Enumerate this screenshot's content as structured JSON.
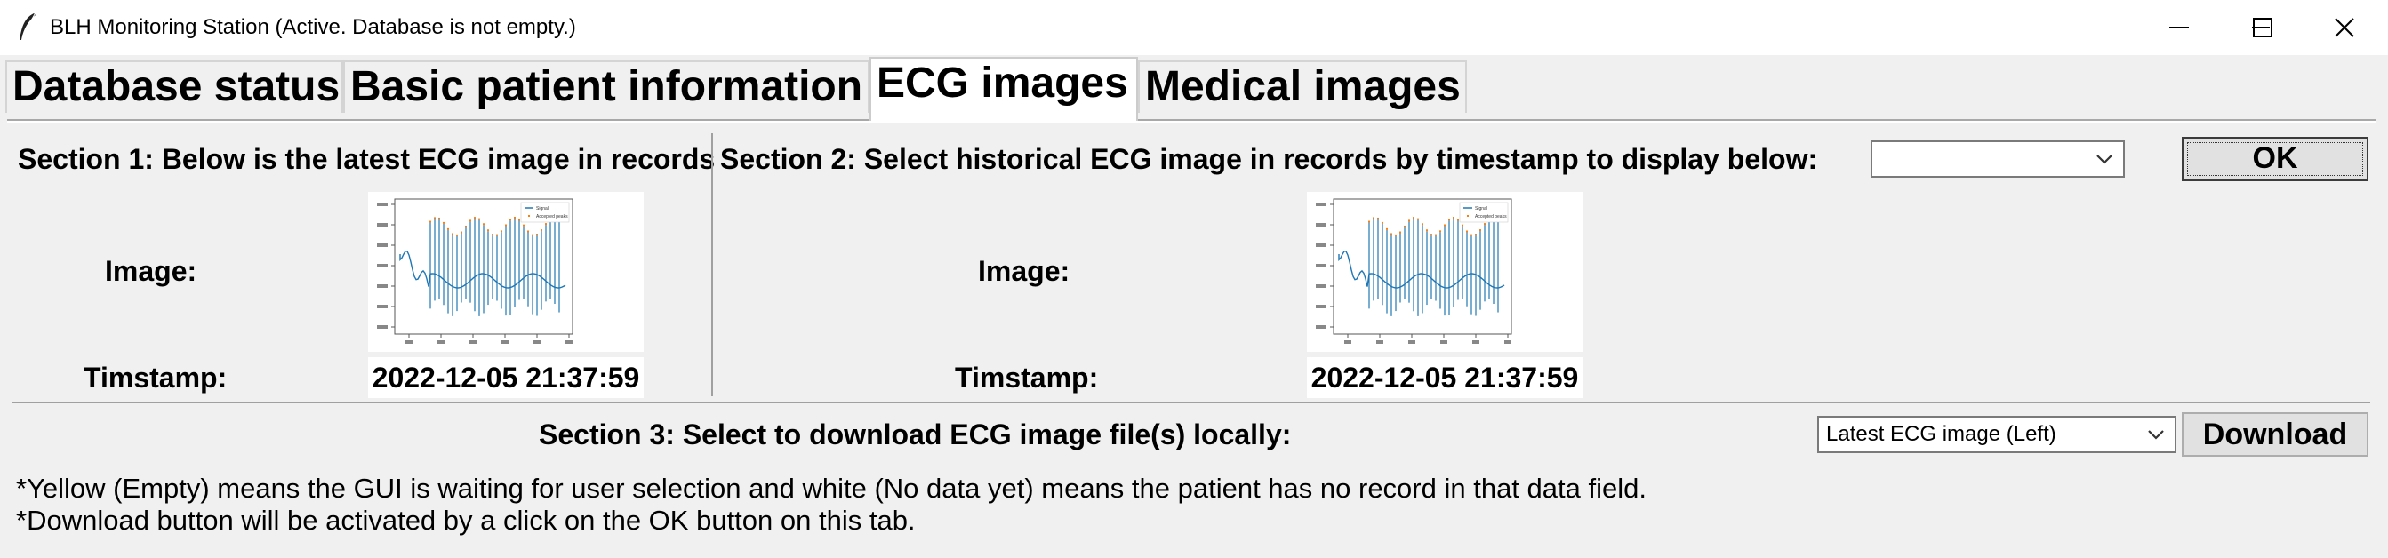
{
  "window": {
    "title": "BLH Monitoring Station (Active. Database is not empty.)",
    "app_icon": "feather-icon",
    "controls": [
      "minimize-icon",
      "maximize-icon",
      "close-icon"
    ]
  },
  "tabs": [
    {
      "label": "Database status",
      "active": false
    },
    {
      "label": "Basic patient information",
      "active": false
    },
    {
      "label": "ECG images",
      "active": true
    },
    {
      "label": "Medical images",
      "active": false
    }
  ],
  "section1": {
    "heading": "Section 1: Below is the latest ECG image in records",
    "image_label": "Image:",
    "timestamp_label": "Timstamp:",
    "timestamp_value": "2022-12-05 21:37:59"
  },
  "section2": {
    "heading": "Section 2: Select historical ECG image in records by timestamp to display below:",
    "select_value": "",
    "ok_label": "OK",
    "image_label": "Image:",
    "timestamp_label": "Timstamp:",
    "timestamp_value": "2022-12-05 21:37:59"
  },
  "section3": {
    "heading": "Section 3: Select to download ECG image file(s) locally:",
    "select_value": "Latest ECG image (Left)",
    "download_label": "Download"
  },
  "notes": [
    "*Yellow (Empty) means the GUI is waiting for user selection and white (No data yet) means the patient has no record in that data field.",
    "*Download button will be activated by a click on the OK button on this tab."
  ],
  "thumbnail_legend": [
    "Signal",
    "Accepted peaks"
  ],
  "colors": {
    "signal": "#1f77b4",
    "peaks": "#ff7f0e",
    "window_bg": "#f0f0f0"
  }
}
